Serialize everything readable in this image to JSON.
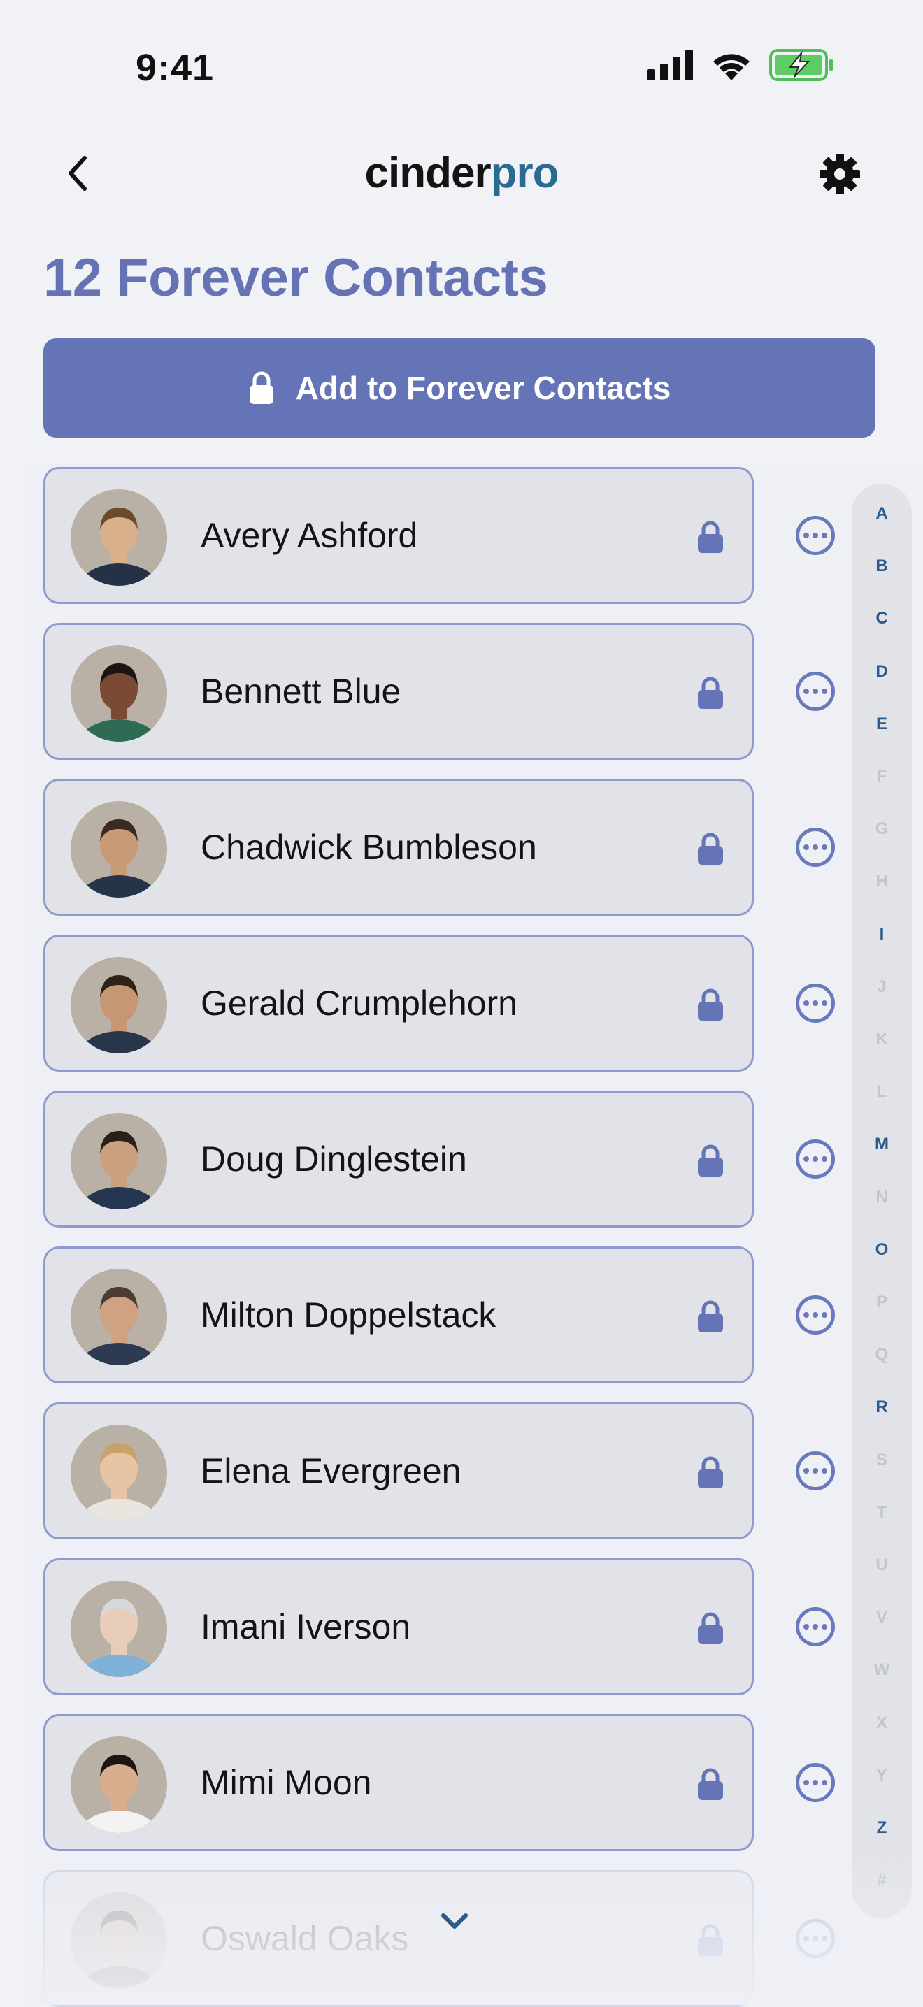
{
  "status_bar": {
    "time": "9:41"
  },
  "nav": {
    "logo_part1": "cinder",
    "logo_part2": "pro",
    "back_icon": "chevron-left-icon",
    "settings_icon": "gear-icon"
  },
  "page": {
    "title": "12 Forever Contacts"
  },
  "add_button": {
    "label": "Add to Forever Contacts",
    "icon": "lock-icon"
  },
  "contacts": [
    {
      "name": "Avery Ashford"
    },
    {
      "name": "Bennett Blue"
    },
    {
      "name": "Chadwick Bumbleson"
    },
    {
      "name": "Gerald Crumplehorn"
    },
    {
      "name": "Doug Dinglestein"
    },
    {
      "name": "Milton Doppelstack"
    },
    {
      "name": "Elena Evergreen"
    },
    {
      "name": "Imani Iverson"
    },
    {
      "name": "Mimi Moon"
    },
    {
      "name": "Oswald Oaks"
    }
  ],
  "index_letters": [
    {
      "letter": "A",
      "active": true
    },
    {
      "letter": "B",
      "active": true
    },
    {
      "letter": "C",
      "active": true
    },
    {
      "letter": "D",
      "active": true
    },
    {
      "letter": "E",
      "active": true
    },
    {
      "letter": "F",
      "active": false
    },
    {
      "letter": "G",
      "active": false
    },
    {
      "letter": "H",
      "active": false
    },
    {
      "letter": "I",
      "active": true
    },
    {
      "letter": "J",
      "active": false
    },
    {
      "letter": "K",
      "active": false
    },
    {
      "letter": "L",
      "active": false
    },
    {
      "letter": "M",
      "active": true
    },
    {
      "letter": "N",
      "active": false
    },
    {
      "letter": "O",
      "active": true
    },
    {
      "letter": "P",
      "active": false
    },
    {
      "letter": "Q",
      "active": false
    },
    {
      "letter": "R",
      "active": true
    },
    {
      "letter": "S",
      "active": false
    },
    {
      "letter": "T",
      "active": false
    },
    {
      "letter": "U",
      "active": false
    },
    {
      "letter": "V",
      "active": false
    },
    {
      "letter": "W",
      "active": false
    },
    {
      "letter": "X",
      "active": false
    },
    {
      "letter": "Y",
      "active": false
    },
    {
      "letter": "Z",
      "active": true
    },
    {
      "letter": "#",
      "active": false
    }
  ],
  "colors": {
    "accent": "#6574b6",
    "row_border": "#8f9bcd",
    "logo_pro": "#2a6b94",
    "index_active": "#2c5a8c"
  }
}
